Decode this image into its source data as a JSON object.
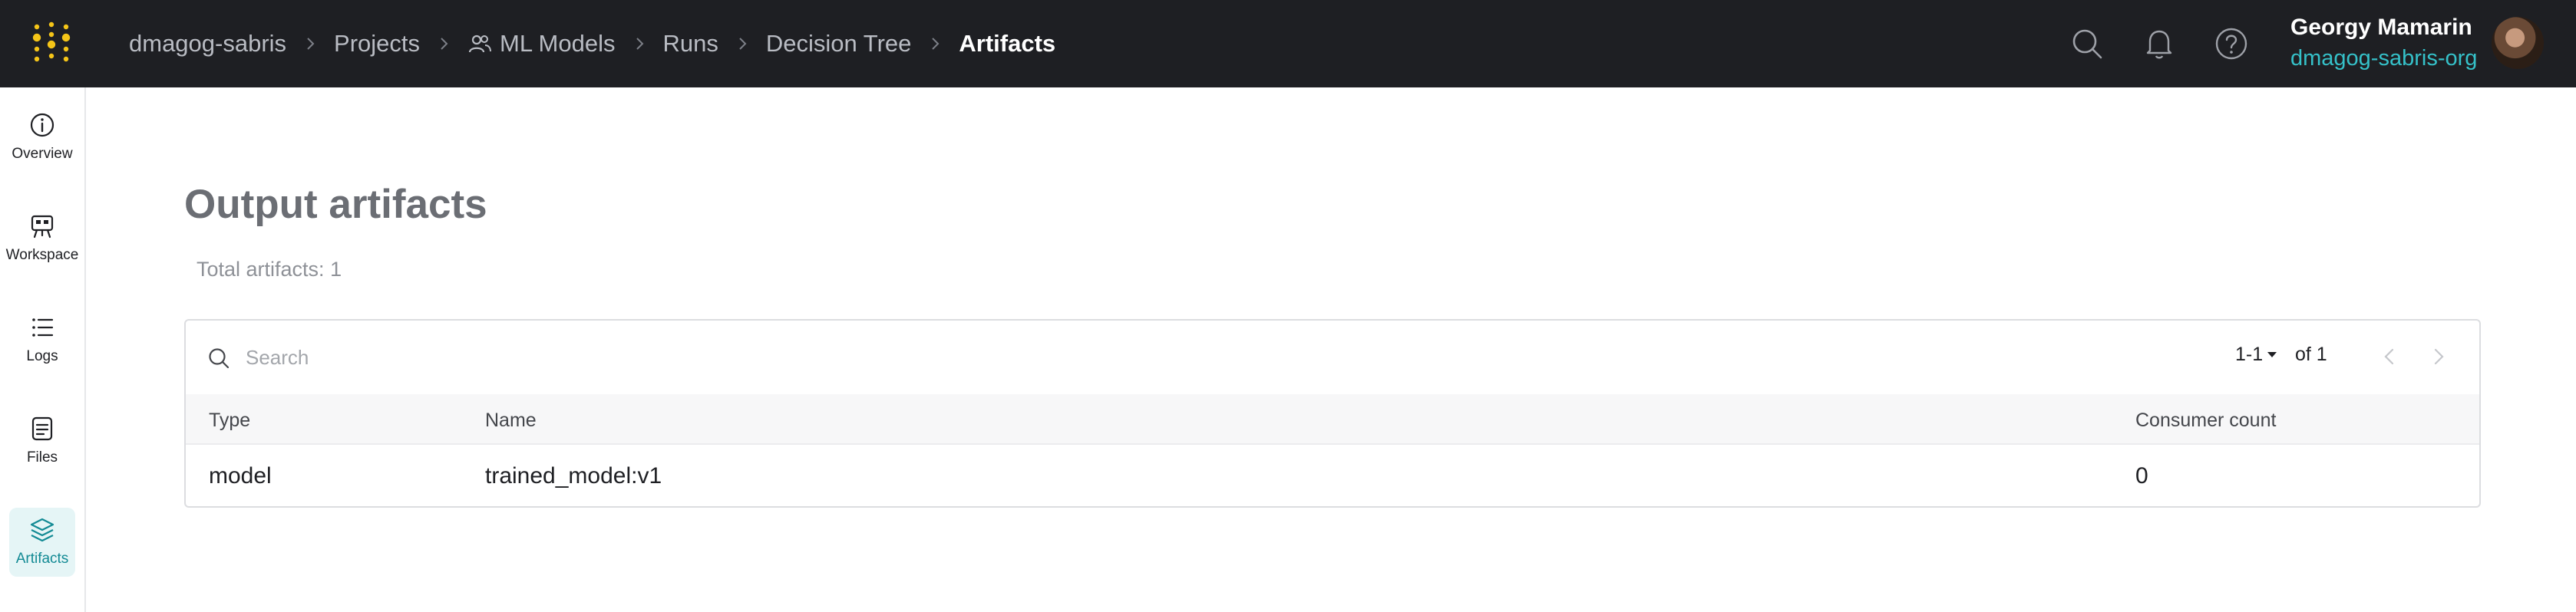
{
  "topbar": {
    "breadcrumb": [
      "dmagog-sabris",
      "Projects",
      "ML Models",
      "Runs",
      "Decision Tree"
    ],
    "current": "Artifacts",
    "user_name": "Georgy Mamarin",
    "user_org": "dmagog-sabris-org",
    "icons": [
      "search-icon",
      "bell-icon",
      "help-icon"
    ],
    "logo_color": "#f5c518"
  },
  "sidenav": {
    "items": [
      {
        "label": "Overview",
        "icon": "info-icon"
      },
      {
        "label": "Workspace",
        "icon": "workspace-icon"
      },
      {
        "label": "Logs",
        "icon": "list-icon"
      },
      {
        "label": "Files",
        "icon": "file-icon"
      },
      {
        "label": "Artifacts",
        "icon": "layers-icon",
        "active": true
      }
    ]
  },
  "main": {
    "title": "Output artifacts",
    "total": "Total artifacts: 1",
    "search": {
      "placeholder": "Search"
    },
    "pager": {
      "range": "1-1",
      "of": "of 1"
    },
    "columns": [
      "Type",
      "Name",
      "Consumer count"
    ],
    "rows": [
      {
        "type": "model",
        "name": "trained_model:v1",
        "consumers": "0"
      }
    ]
  },
  "colors": {
    "topbar": "#1e1f23",
    "accent": "#35c1c9",
    "active_nav_bg": "#e5f5f6"
  }
}
